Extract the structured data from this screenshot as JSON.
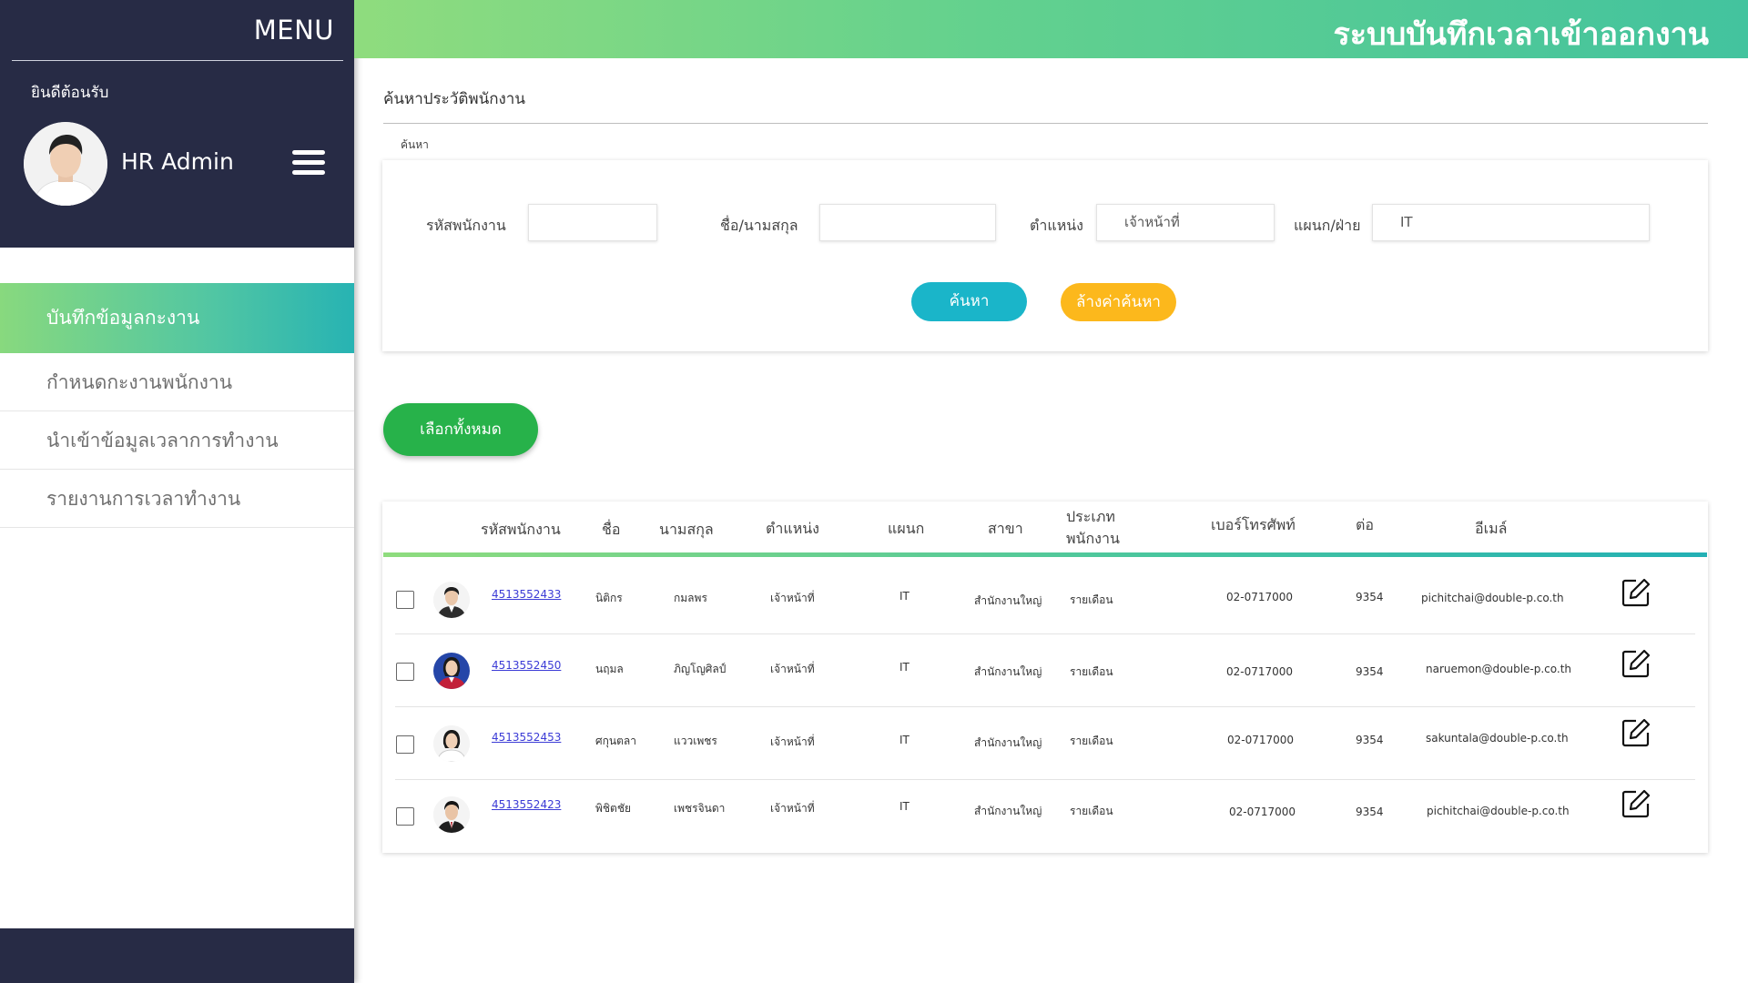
{
  "sidebar": {
    "menu_title": "MENU",
    "welcome": "ยินดีต้อนรับ",
    "user_name": "HR Admin",
    "items": [
      {
        "label": "บันทึกข้อมูลกะงาน",
        "active": true
      },
      {
        "label": "กำหนดกะงานพนักงาน",
        "active": false
      },
      {
        "label": "นำเข้าข้อมูลเวลาการทำงาน",
        "active": false
      },
      {
        "label": "รายงานการเวลาทำงาน",
        "active": false
      }
    ]
  },
  "header": {
    "title": "ระบบบันทึกเวลาเข้าออกงาน"
  },
  "search": {
    "section_title": "ค้นหาประวัติพนักงาน",
    "caption": "ค้นหา",
    "employee_code_label": "รหัสพนักงาน",
    "employee_code_value": "",
    "name_label": "ชื่อ/นามสกุล",
    "name_value": "",
    "position_label": "ตำแหน่ง",
    "position_value": "เจ้าหน้าที่",
    "department_label": "แผนก/ฝ่าย",
    "department_value": "IT",
    "search_button": "ค้นหา",
    "clear_button": "ล้างค่าค้นหา"
  },
  "select_all_button": "เลือกทั้งหมด",
  "table": {
    "headers": {
      "code": "รหัสพนักงาน",
      "first_name": "ชื่อ",
      "last_name": "นามสกุล",
      "position": "ตำแหน่ง",
      "department": "แผนก",
      "branch": "สาขา",
      "type_line1": "ประเภท",
      "type_line2": "พนักงาน",
      "phone": "เบอร์โทรศัพท์",
      "ext": "ต่อ",
      "email": "อีเมล์"
    },
    "rows": [
      {
        "code": "4513552433",
        "first_name": "นิติกร",
        "last_name": "กมลพร",
        "position": "เจ้าหน้าที่",
        "department": "IT",
        "branch": "สำนักงานใหญ่",
        "type": "รายเดือน",
        "phone": "02-0717000",
        "ext": "9354",
        "email": "pichitchai@double-p.co.th",
        "avatar": "man-icon"
      },
      {
        "code": "4513552450",
        "first_name": "นฤมล",
        "last_name": "ภิญโญศิลป์",
        "position": "เจ้าหน้าที่",
        "department": "IT",
        "branch": "สำนักงานใหญ่",
        "type": "รายเดือน",
        "phone": "02-0717000",
        "ext": "9354",
        "email": "naruemon@double-p.co.th",
        "avatar": "woman-icon"
      },
      {
        "code": "4513552453",
        "first_name": "ศกุนตลา",
        "last_name": "แววเพชร",
        "position": "เจ้าหน้าที่",
        "department": "IT",
        "branch": "สำนักงานใหญ่",
        "type": "รายเดือน",
        "phone": "02-0717000",
        "ext": "9354",
        "email": "sakuntala@double-p.co.th",
        "avatar": "woman-icon"
      },
      {
        "code": "4513552423",
        "first_name": "พิชิตชัย",
        "last_name": "เพชรจินดา",
        "position": "เจ้าหน้าที่",
        "department": "IT",
        "branch": "สำนักงานใหญ่",
        "type": "รายเดือน",
        "phone": "02-0717000",
        "ext": "9354",
        "email": "pichitchai@double-p.co.th",
        "avatar": "man-icon"
      }
    ]
  }
}
